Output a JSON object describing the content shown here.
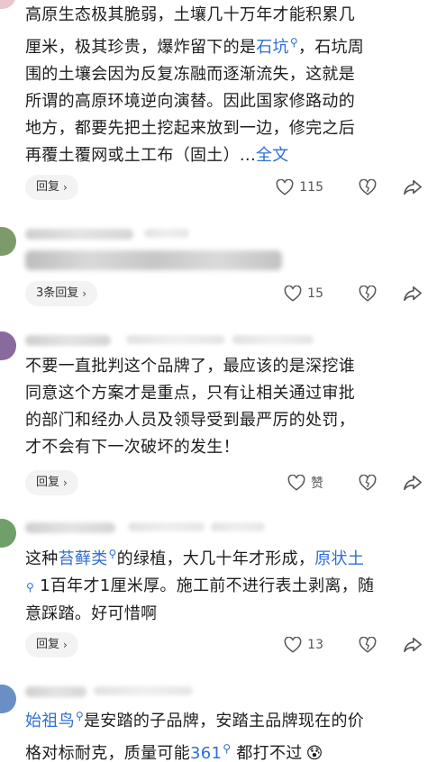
{
  "comments": [
    {
      "text_lines": [
        "高原生态极其脆弱，土壤几十万年才能积累几",
        "厘米，极其珍贵，爆炸留下的是",
        "石坑",
        "，石坑周",
        "围的土壤会因为反复冻融而逐渐流失，这就是",
        "所谓的高原环境逆向演替。因此国家修路动的",
        "地方，都要先把土挖起来放到一边，修完之后",
        "再覆土覆网或土工布（固土）...",
        "全文"
      ],
      "reply_label": "回复",
      "likes": "115"
    },
    {
      "reply_label": "3条回复",
      "likes": "15"
    },
    {
      "text_lines": [
        "不要一直批判这个品牌了，最应该的是深挖谁",
        "同意这个方案才是重点，只有让相关通过审批",
        "的部门和经办人员及领导受到最严厉的处罚，",
        "才不会有下一次破坏的发生！"
      ],
      "reply_label": "回复",
      "likes": "赞"
    },
    {
      "text_parts": [
        "这种",
        "苔藓类",
        "的绿植，大几十年才形成，",
        "原状土",
        "1百年才1厘米厚。施工前不进行表土剥离，随",
        "意踩踏。好可惜啊"
      ],
      "reply_label": "回复",
      "likes": "13"
    },
    {
      "text_parts": [
        "始祖鸟",
        "是安踏的子品牌，安踏主品牌现在的价",
        "格对标耐克，质量可能",
        "361",
        "都打不过"
      ],
      "emoji": "😰"
    }
  ],
  "icons": {
    "like": "heart-outline-icon",
    "dislike": "broken-heart-icon",
    "share": "share-arrow-icon",
    "search_mark": "search-icon"
  },
  "colors": {
    "link": "#2e6fd6",
    "reply_bg": "#f3f3f3"
  }
}
